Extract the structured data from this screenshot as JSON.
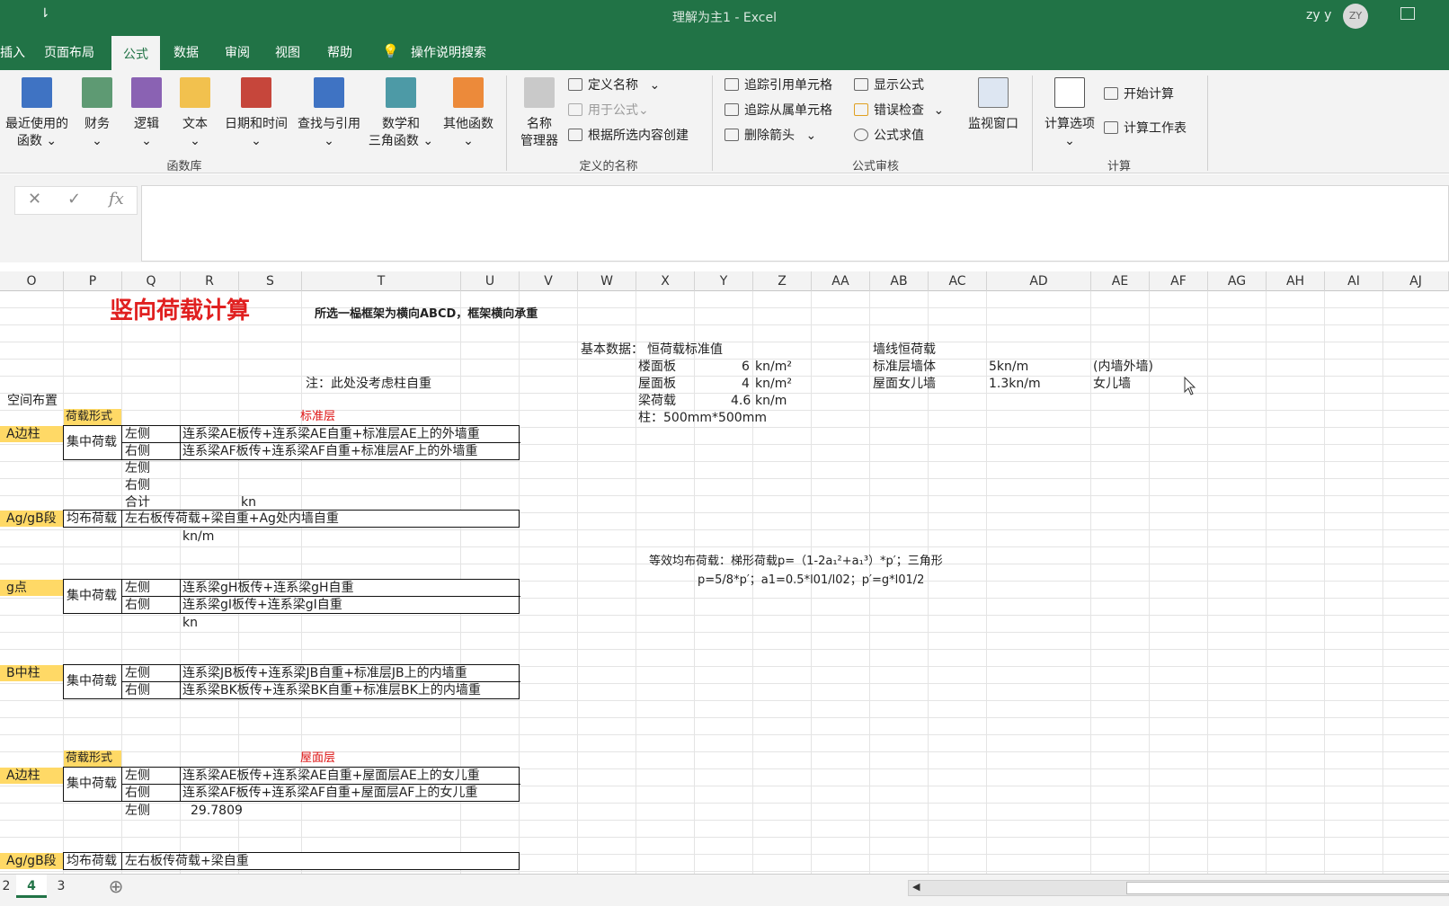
{
  "app": {
    "title": "理解为主1  -  Excel",
    "user": "zy y",
    "avatar": "ZY",
    "qat_arrow": "⇂"
  },
  "tabs": [
    {
      "label": "插入"
    },
    {
      "label": "页面布局"
    },
    {
      "label": "公式"
    },
    {
      "label": "数据"
    },
    {
      "label": "审阅"
    },
    {
      "label": "视图"
    },
    {
      "label": "帮助"
    },
    {
      "label": "操作说明搜索"
    }
  ],
  "ribbon": {
    "func_lib": {
      "group": "函数库",
      "recent": "最近使用的",
      "recent2": "函数 ⌄",
      "finance": "财务",
      "finance2": "⌄",
      "logic": "逻辑",
      "logic2": "⌄",
      "text": "文本",
      "text2": "⌄",
      "datetime": "日期和时间",
      "datetime2": "⌄",
      "lookup": "查找与引用",
      "lookup2": "⌄",
      "math": "数学和",
      "math2": "三角函数 ⌄",
      "other": "其他函数",
      "other2": "⌄"
    },
    "names": {
      "group": "定义的名称",
      "manager": "名称",
      "manager2": "管理器",
      "define": "定义名称",
      "define_arrow": "⌄",
      "use": "用于公式",
      "use_arrow": "⌄",
      "create": "根据所选内容创建"
    },
    "audit": {
      "group": "公式审核",
      "trace_prec": "追踪引用单元格",
      "trace_dep": "追踪从属单元格",
      "remove": "删除箭头",
      "remove_arrow": "⌄",
      "show": "显示公式",
      "errcheck": "错误检查",
      "errcheck_arrow": "⌄",
      "eval": "公式求值",
      "watch": "监视窗口"
    },
    "calc": {
      "group": "计算",
      "options": "计算选项",
      "options_arrow": "⌄",
      "calc_now": "开始计算",
      "calc_sheet": "计算工作表"
    }
  },
  "formula_bar": {
    "cancel": "✕",
    "enter": "✓",
    "fx": "fx",
    "value": ""
  },
  "columns": [
    "O",
    "P",
    "Q",
    "R",
    "S",
    "T",
    "U",
    "V",
    "W",
    "X",
    "Y",
    "Z",
    "AA",
    "AB",
    "AC",
    "AD",
    "AE",
    "AF",
    "AG",
    "AH",
    "AI",
    "AJ"
  ],
  "sheet": {
    "title": "竖向荷载计算",
    "subtitle": "所选一榀框架为横向ABCD，框架横向承重",
    "basic": "基本数据：",
    "dead_std": "恒荷载标准值",
    "floor_slab": "楼面板",
    "floor_val": "6",
    "unit_kn_m2": "kn/m²",
    "roof_slab": "屋面板",
    "roof_val": "4",
    "beam_load": "梁荷载",
    "beam_val": "4.6",
    "unit_kn_m": "kn/m",
    "column": "柱：500mm*500mm",
    "wall_dead": "墙线恒荷载",
    "std_wall": "标准层墙体",
    "std_wall_val": "5kn/m",
    "std_wall_note": "(内墙外墙)",
    "parapet": "屋面女儿墙",
    "parapet_val": "1.3kn/m",
    "parapet_note": "女儿墙",
    "note": "注：此处没考虑柱自重",
    "space": "空间布置",
    "load_form": "荷载形式",
    "std_floor": "标准层",
    "roof_floor": "屋面层",
    "a_col": "A边柱",
    "concentrated": "集中荷载",
    "left": "左侧",
    "right": "右侧",
    "total": "合计",
    "kn": "kn",
    "knm": "kn/m",
    "a_left": "连系梁AE板传+连系梁AE自重+标准层AE上的外墙重",
    "a_right": "连系梁AF板传+连系梁AF自重+标准层AF上的外墙重",
    "agb": "Ag/gB段",
    "uniform": "均布荷载",
    "agb_text": "左右板传荷载+梁自重+Ag处内墙自重",
    "g_pt": "g点",
    "g_left": "连系梁gH板传+连系梁gH自重",
    "g_right": "连系梁gI板传+连系梁gI自重",
    "b_col": "B中柱",
    "b_left": "连系梁JB板传+连系梁JB自重+标准层JB上的内墙重",
    "b_right": "连系梁BK板传+连系梁BK自重+标准层BK上的内墙重",
    "equiv1": "等效均布荷载：梯形荷载p=（1-2a₁²+a₁³）*p′；三角形",
    "equiv2": "p=5/8*p′；a1=0.5*l01/l02；p′=g*l01/2",
    "ra_left": "连系梁AE板传+连系梁AE自重+屋面层AE上的女儿重",
    "ra_right": "连系梁AF板传+连系梁AF自重+屋面层AF上的女儿重",
    "ra_val": "29.7809",
    "ragb_text": "左右板传荷载+梁自重"
  },
  "sheet_tabs": [
    {
      "label": "2"
    },
    {
      "label": "4"
    },
    {
      "label": "3"
    }
  ],
  "add_sheet": "⊕"
}
